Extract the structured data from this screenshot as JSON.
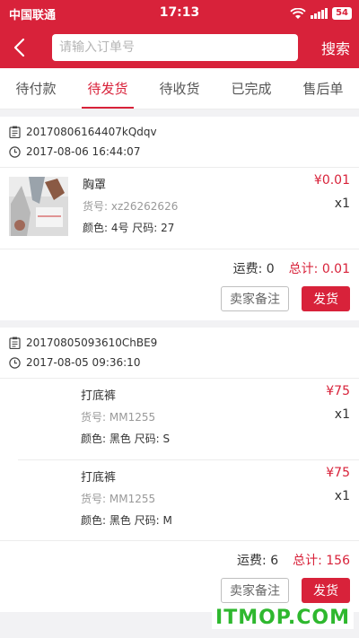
{
  "status_bar": {
    "carrier": "中国联通",
    "time": "17:13",
    "battery": "54"
  },
  "search": {
    "placeholder": "请输入订单号",
    "button_label": "搜索"
  },
  "tabs": [
    {
      "label": "待付款"
    },
    {
      "label": "待发货"
    },
    {
      "label": "待收货"
    },
    {
      "label": "已完成"
    },
    {
      "label": "售后单"
    }
  ],
  "active_tab": "待发货",
  "orders": [
    {
      "order_no": "20170806164407kQdqv",
      "datetime": "2017-08-06 16:44:07",
      "items": [
        {
          "name": "胸罩",
          "code": "货号: xz26262626",
          "spec": "颜色: 4号 尺码: 27",
          "price": "¥0.01",
          "qty": "x1"
        }
      ],
      "shipping": "运费: 0",
      "total": "总计: 0.01",
      "note_label": "卖家备注",
      "ship_label": "发货"
    },
    {
      "order_no": "20170805093610ChBE9",
      "datetime": "2017-08-05 09:36:10",
      "items": [
        {
          "name": "打底裤",
          "code": "货号: MM1255",
          "spec": "颜色: 黑色 尺码: S",
          "price": "¥75",
          "qty": "x1"
        },
        {
          "name": "打底裤",
          "code": "货号: MM1255",
          "spec": "颜色: 黑色 尺码: M",
          "price": "¥75",
          "qty": "x1"
        }
      ],
      "shipping": "运费: 6",
      "total": "总计: 156",
      "note_label": "卖家备注",
      "ship_label": "发货"
    }
  ],
  "watermark": "ITMOP.COM",
  "colors": {
    "brand": "#d8223a",
    "watermark": "#2eb82e"
  }
}
